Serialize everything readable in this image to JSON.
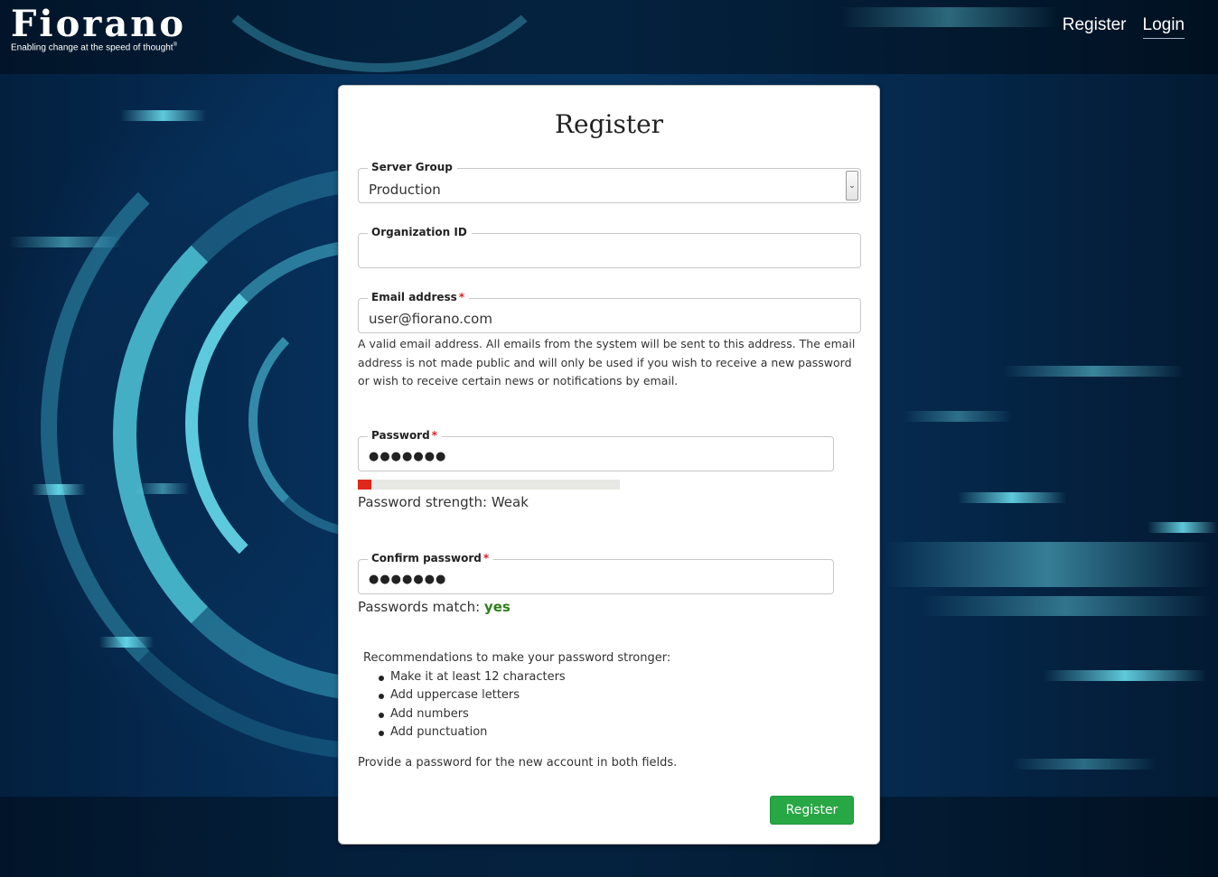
{
  "brand": {
    "logo_text": "Fiorano",
    "tagline": "Enabling change at the speed of thought",
    "trademark": "®"
  },
  "nav": {
    "register": "Register",
    "login": "Login"
  },
  "form": {
    "title": "Register",
    "server_group": {
      "label": "Server Group",
      "value": "Production"
    },
    "organization_id": {
      "label": "Organization ID",
      "value": ""
    },
    "email": {
      "label": "Email address",
      "required_mark": "*",
      "value": "user@fiorano.com",
      "help": "A valid email address. All emails from the system will be sent to this address. The email address is not made public and will only be used if you wish to receive a new password or wish to receive certain news or notifications by email."
    },
    "password": {
      "label": "Password",
      "required_mark": "*",
      "masked": "●●●●●●●"
    },
    "strength": {
      "label": "Password strength:",
      "value": "Weak",
      "level": 0.05,
      "color": "#e0281a"
    },
    "confirm_password": {
      "label": "Confirm password",
      "required_mark": "*",
      "masked": "●●●●●●●"
    },
    "match": {
      "label": "Passwords match:",
      "value": "yes"
    },
    "recommendations": {
      "heading": "Recommendations to make your password stronger:",
      "items": [
        "Make it at least 12 characters",
        "Add uppercase letters",
        "Add numbers",
        "Add punctuation"
      ]
    },
    "provide_text": "Provide a password for the new account in both fields.",
    "submit": "Register"
  },
  "colors": {
    "submit": "#28a745",
    "required": "#e02020",
    "match_ok": "#2e7d1a"
  }
}
